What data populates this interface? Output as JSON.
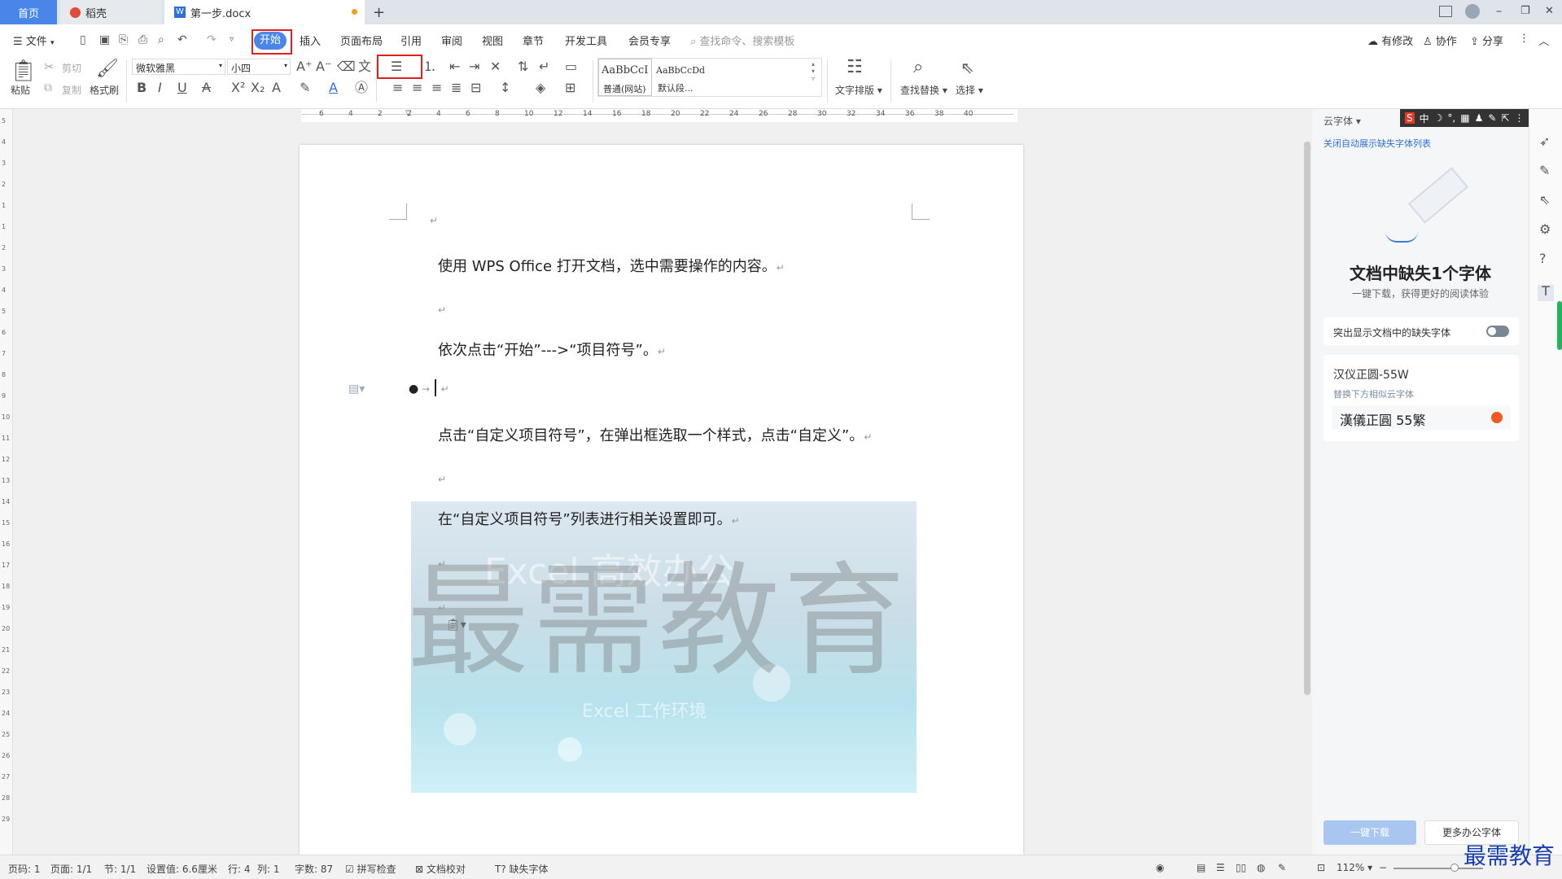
{
  "tabs": {
    "home": "首页",
    "daoke": "稻壳",
    "doc": "第一步.docx",
    "add": "+"
  },
  "window_controls": {
    "min": "–",
    "max": "❐",
    "close": "✕"
  },
  "menu": {
    "file": "文件",
    "items": [
      "开始",
      "插入",
      "页面布局",
      "引用",
      "审阅",
      "视图",
      "章节",
      "开发工具",
      "会员专享"
    ],
    "search_placeholder": "查找命令、搜索模板",
    "right": [
      "有修改",
      "协作",
      "分享"
    ]
  },
  "ribbon": {
    "paste": "粘贴",
    "cut": "剪切",
    "copy": "复制",
    "format_painter": "格式刷",
    "font": "微软雅黑",
    "size": "小四",
    "style_normal_preview": "AaBbCcI",
    "style_normal": "普通(网站)",
    "style_default_preview": "AaBbCcDd",
    "style_default": "默认段...",
    "text_layout": "文字排版",
    "find_replace": "查找替换",
    "select": "选择"
  },
  "ruler_numbers": [
    "6",
    "4",
    "2",
    "2",
    "4",
    "6",
    "8",
    "10",
    "12",
    "14",
    "16",
    "18",
    "20",
    "22",
    "24",
    "26",
    "28",
    "30",
    "32",
    "34",
    "36",
    "38",
    "40"
  ],
  "document": {
    "para1": "使用 WPS Office 打开文档，选中需要操作的内容。",
    "para2": "依次点击“开始”--->“项目符号”。",
    "para3": "点击“自定义项目符号”，在弹出框选取一个样式，点击“自定义”。",
    "para4": "在“自定义项目符号”列表进行相关设置即可。",
    "watermark": "最需教育",
    "image_text1": "Excel 高效办公",
    "image_text2": "Excel 工作环境"
  },
  "right_pane": {
    "header": "云字体",
    "toolbar_chars": [
      "S",
      "中",
      "☽",
      "°,",
      "▦",
      "♟",
      "✎",
      "⇱",
      "⋮"
    ],
    "link": "关闭自动展示缺失字体列表",
    "title": "文档中缺失1个字体",
    "subtitle": "一键下载，获得更好的阅读体验",
    "toggle_label": "突出显示文档中的缺失字体",
    "font_name": "汉仪正圆-55W",
    "replace_hint": "替换下方相似云字体",
    "font_sample": "漢儀正圓 55繁",
    "download_btn": "一键下载",
    "more_btn": "更多办公字体"
  },
  "status": {
    "page": "页码: 1",
    "pages": "页面: 1/1",
    "section": "节: 1/1",
    "setting": "设置值: 6.6厘米",
    "row": "行: 4",
    "col": "列: 1",
    "words": "字数: 87",
    "spell": "拼写检查",
    "proof": "文档校对",
    "missing_font": "缺失字体",
    "zoom": "112%"
  },
  "corner_logo": "最需教育",
  "colors": {
    "accent": "#2f6fd8",
    "highlight_box": "#e02020",
    "tab_active": "#4a86e8"
  }
}
